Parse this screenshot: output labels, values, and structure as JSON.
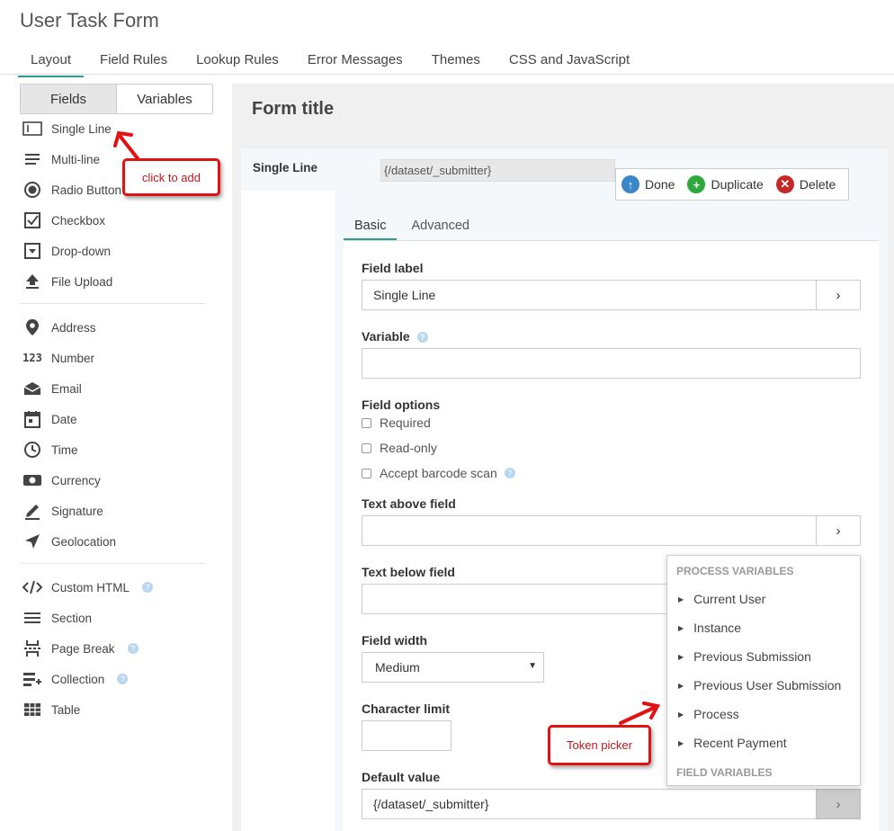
{
  "app": {
    "title": "User Task Form"
  },
  "tabs": [
    "Layout",
    "Field Rules",
    "Lookup Rules",
    "Error Messages",
    "Themes",
    "CSS and JavaScript"
  ],
  "palette": {
    "segment": {
      "fields": "Fields",
      "variables": "Variables"
    },
    "items": [
      {
        "label": "Single Line",
        "icon": "single-line-icon"
      },
      {
        "label": "Multi-line",
        "icon": "multi-line-icon"
      },
      {
        "label": "Radio Button",
        "icon": "radio-button-icon"
      },
      {
        "label": "Checkbox",
        "icon": "checkbox-icon"
      },
      {
        "label": "Drop-down",
        "icon": "dropdown-icon"
      },
      {
        "label": "File Upload",
        "icon": "upload-icon"
      },
      {
        "label": "Address",
        "icon": "map-pin-icon"
      },
      {
        "label": "Number",
        "icon": "number-icon"
      },
      {
        "label": "Email",
        "icon": "envelope-icon"
      },
      {
        "label": "Date",
        "icon": "calendar-icon"
      },
      {
        "label": "Time",
        "icon": "clock-icon"
      },
      {
        "label": "Currency",
        "icon": "currency-icon"
      },
      {
        "label": "Signature",
        "icon": "pen-icon"
      },
      {
        "label": "Geolocation",
        "icon": "location-arrow-icon"
      },
      {
        "label": "Custom HTML",
        "icon": "code-icon"
      },
      {
        "label": "Section",
        "icon": "section-icon"
      },
      {
        "label": "Page Break",
        "icon": "page-break-icon"
      },
      {
        "label": "Collection",
        "icon": "collection-icon"
      },
      {
        "label": "Table",
        "icon": "table-icon"
      }
    ]
  },
  "callouts": {
    "click_to_add": "click to add",
    "token_picker": "Token picker"
  },
  "form": {
    "title": "Form title",
    "field_type": "Single Line",
    "preview_value": "{/dataset/_submitter}",
    "toolbar": {
      "done": "Done",
      "duplicate": "Duplicate",
      "delete": "Delete"
    },
    "subtabs": {
      "basic": "Basic",
      "advanced": "Advanced"
    },
    "field_label": {
      "label": "Field label",
      "value": "Single Line"
    },
    "variable": {
      "label": "Variable",
      "value": ""
    },
    "field_options": {
      "label": "Field options",
      "required": "Required",
      "read_only": "Read-only",
      "barcode": "Accept barcode scan"
    },
    "text_above": {
      "label": "Text above field",
      "value": ""
    },
    "text_below": {
      "label": "Text below field",
      "value": ""
    },
    "field_width": {
      "label": "Field width",
      "value": "Medium"
    },
    "char_limit": {
      "label": "Character limit",
      "value": ""
    },
    "default_value": {
      "label": "Default value",
      "value": "{/dataset/_submitter}"
    }
  },
  "token_picker": {
    "process_header": "PROCESS VARIABLES",
    "items": [
      "Current User",
      "Instance",
      "Previous Submission",
      "Previous User Submission",
      "Process",
      "Recent Payment"
    ],
    "field_header": "FIELD VARIABLES"
  },
  "colors": {
    "accent": "#2a9d8f",
    "callout": "#e21212",
    "done": "#3a86c8",
    "duplicate": "#2eaa3c",
    "delete": "#c62828"
  }
}
